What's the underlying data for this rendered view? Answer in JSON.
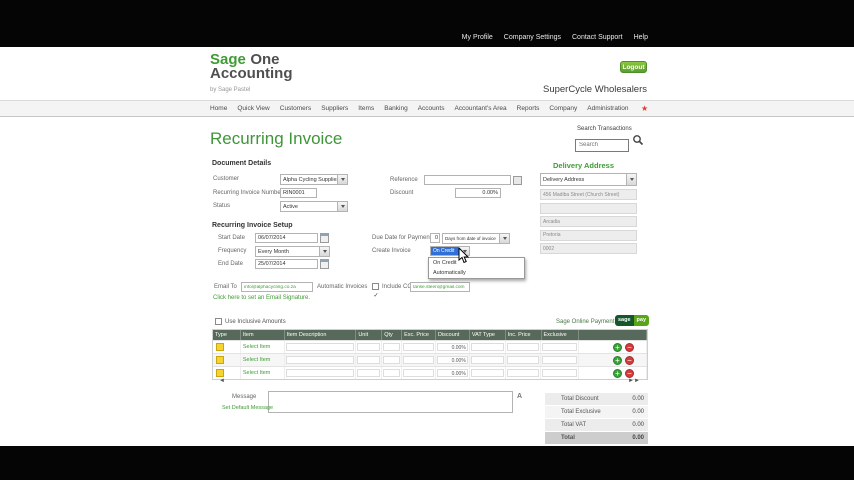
{
  "topbar": {
    "links": [
      "My Profile",
      "Company Settings",
      "Contact Support",
      "Help"
    ]
  },
  "header": {
    "brand": {
      "sage": "Sage",
      "one": "One",
      "line2": "Accounting",
      "tagline": "by Sage Pastel"
    },
    "logout_label": "Logout",
    "company_name": "SuperCycle Wholesalers"
  },
  "nav": {
    "items": [
      "Home",
      "Quick View",
      "Customers",
      "Suppliers",
      "Items",
      "Banking",
      "Accounts",
      "Accountant's Area",
      "Reports",
      "Company",
      "Administration"
    ]
  },
  "search": {
    "label": "Search Transactions",
    "placeholder": "Search"
  },
  "page_title": "Recurring Invoice",
  "document_details": {
    "section_title": "Document Details",
    "customer": {
      "label": "Customer",
      "value": "Alpha Cycling Supplies"
    },
    "recurring_invoice_number": {
      "label": "Recurring Invoice Number",
      "value": "RIN0001"
    },
    "status": {
      "label": "Status",
      "value": "Active"
    },
    "reference": {
      "label": "Reference",
      "value": ""
    },
    "discount": {
      "label": "Discount",
      "value": "0.00%"
    }
  },
  "delivery_address": {
    "section_title": "Delivery Address",
    "selector_value": "Delivery Address",
    "lines": [
      "456 Madiba Street (Church Street)",
      "",
      "Arcadia",
      "Pretoria",
      "0002"
    ]
  },
  "setup": {
    "section_title": "Recurring Invoice Setup",
    "start_date": {
      "label": "Start Date",
      "value": "06/07/2014"
    },
    "frequency": {
      "label": "Frequency",
      "value": "Every Month"
    },
    "end_date": {
      "label": "End Date",
      "value": "25/07/2014"
    },
    "due_date": {
      "label": "Due Date for Payment",
      "days_value": "0",
      "unit_value": "Days from date of invoice"
    },
    "create_invoice": {
      "label": "Create Invoice",
      "value": "On Credit",
      "options": [
        "On Credit",
        "Automatically"
      ]
    },
    "email": {
      "label": "Email To",
      "value": "info@alphacycling.co.za",
      "automatic_label": "Automatic Invoices",
      "include_cc_label": "Include CC",
      "cc_value": "tarise.steen@gmail.com"
    },
    "signature_link": "Click here to set an Email Signature."
  },
  "line_items": {
    "inclusive_checkbox_label": "Use Inclusive Amounts",
    "online_payment_label": "Sage Online Payment",
    "online_payment_buttons": [
      "sage",
      "pay"
    ],
    "columns": [
      "Type",
      "Item",
      "Item Description",
      "Unit",
      "Qty",
      "Exc. Price",
      "Discount",
      "VAT Type",
      "Inc. Price",
      "Exclusive",
      ""
    ],
    "rows": [
      {
        "select_item": "Select Item",
        "discount": "0.00%"
      },
      {
        "select_item": "Select Item",
        "discount": "0.00%"
      },
      {
        "select_item": "Select Item",
        "discount": "0.00%"
      }
    ]
  },
  "message": {
    "label": "Message",
    "value": "",
    "set_default_link": "Set Default Message"
  },
  "totals": {
    "rows": [
      {
        "label": "Total Discount",
        "value": "0.00"
      },
      {
        "label": "Total Exclusive",
        "value": "0.00"
      },
      {
        "label": "Total VAT",
        "value": "0.00"
      },
      {
        "label": "Total",
        "value": "0.00"
      }
    ]
  },
  "icons": {
    "add_row": "+",
    "remove_row": "−",
    "favorite_star": "★",
    "prev_page": "◄",
    "next_page": "►►",
    "font_size": "A"
  }
}
